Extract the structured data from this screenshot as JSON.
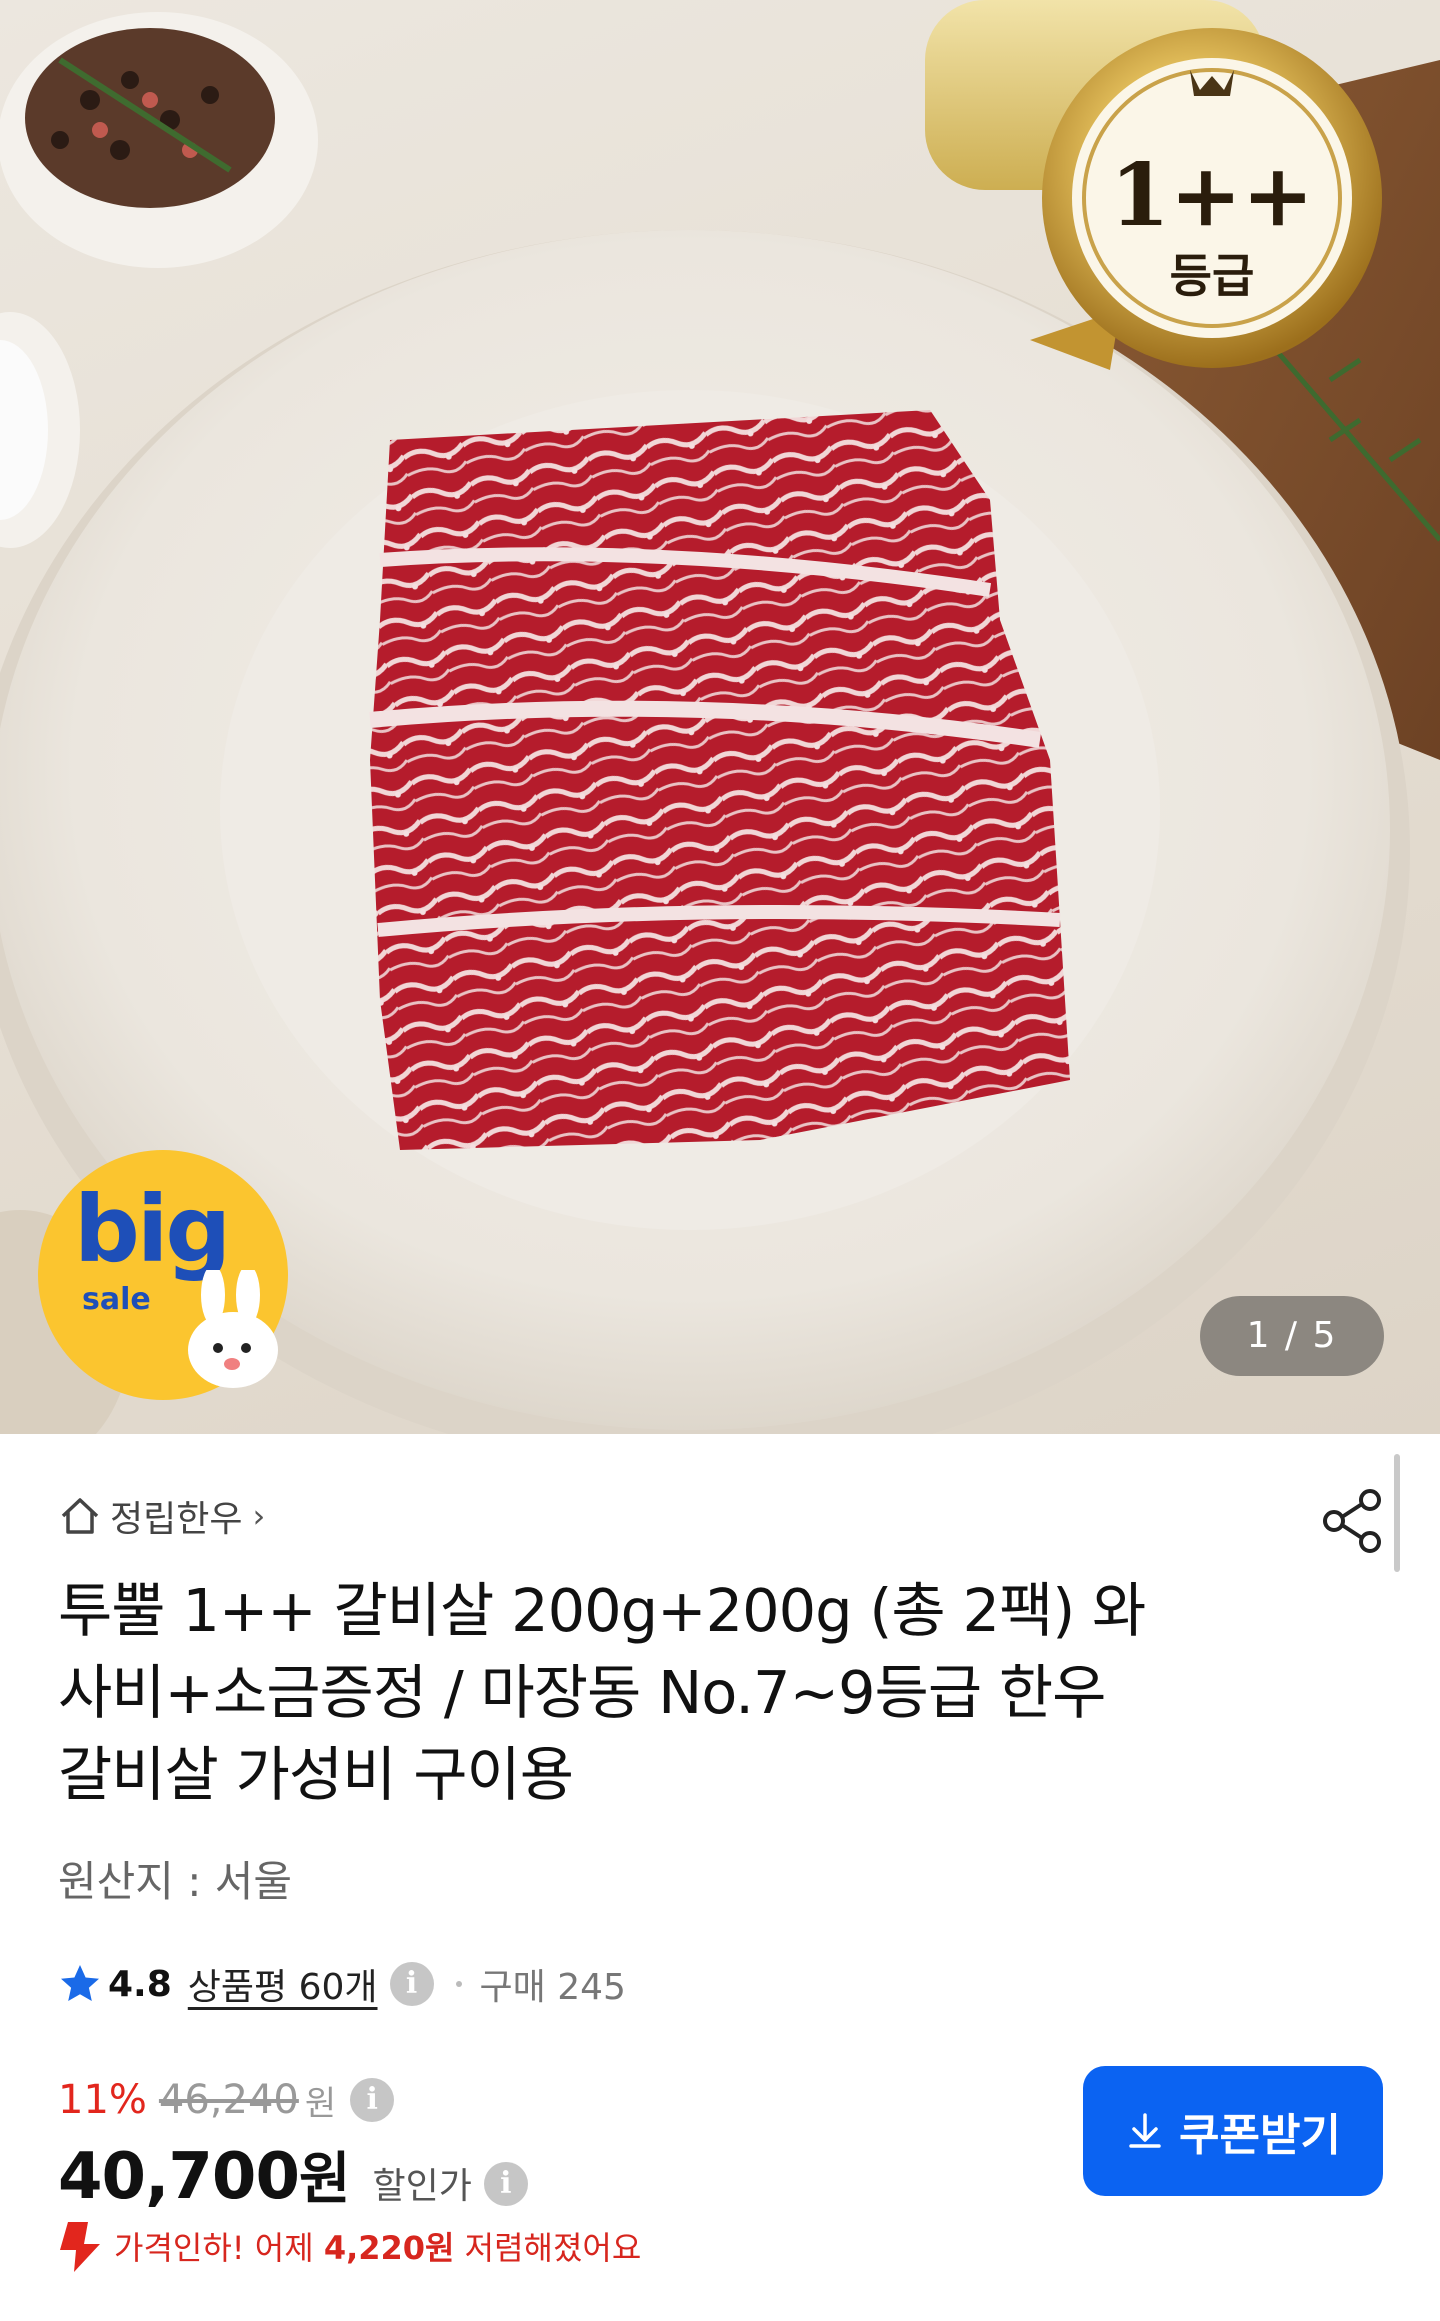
{
  "hero": {
    "badge_grade": "1++",
    "badge_label": "등급",
    "promo_big": "big",
    "promo_sale": "sale",
    "image_counter": "1 / 5"
  },
  "shop": {
    "name": "정립한우",
    "chevron": "›",
    "icon": "home-icon"
  },
  "share": {
    "icon": "share-icon"
  },
  "product": {
    "title_line1": "투뿔 1++ 갈비살 200g+200g (총 2팩) 와",
    "title_line2": "사비+소금증정 / 마장동 No.7~9등급 한우",
    "title_line3": "갈비살 가성비 구이용",
    "origin": "원산지 : 서울"
  },
  "rating": {
    "score": "4.8",
    "review_label": "상품평 60개",
    "purchase": "구매 245",
    "info_icon": "i"
  },
  "pricing": {
    "discount_rate": "11%",
    "original_price": "46,240",
    "original_unit": "원",
    "sale_price": "40,700",
    "sale_unit": "원",
    "sale_label": "할인가",
    "drop_prefix": "가격인하! 어제 ",
    "drop_amount": "4,220원",
    "drop_suffix": " 저렴해졌어요"
  },
  "coupon": {
    "label": "쿠폰받기",
    "icon": "download-icon"
  },
  "colors": {
    "accent_blue": "#0b63f2",
    "discount_red": "#e2261d",
    "promo_yellow": "#fbc52f",
    "star_blue": "#1a6ae8"
  }
}
